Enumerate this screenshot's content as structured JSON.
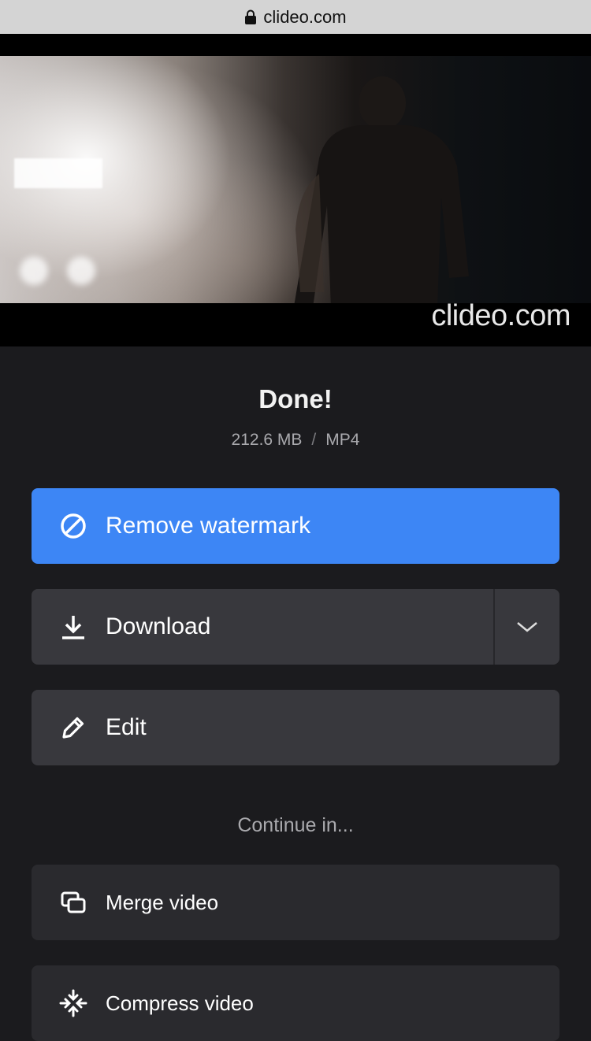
{
  "browser": {
    "url": "clideo.com",
    "lock_icon": "lock-icon"
  },
  "video": {
    "watermark": "clideo.com"
  },
  "result": {
    "title": "Done!",
    "size": "212.6 MB",
    "separator": "/",
    "format": "MP4"
  },
  "actions": {
    "remove_watermark": {
      "label": "Remove watermark",
      "icon": "no-symbol-icon"
    },
    "download": {
      "label": "Download",
      "icon": "download-icon",
      "dropdown_icon": "chevron-down-icon"
    },
    "edit": {
      "label": "Edit",
      "icon": "pencil-icon"
    }
  },
  "continue": {
    "heading": "Continue in...",
    "items": [
      {
        "label": "Merge video",
        "icon": "merge-icon"
      },
      {
        "label": "Compress video",
        "icon": "compress-icon"
      }
    ]
  },
  "colors": {
    "accent": "#3d86f5",
    "background": "#1b1b1e",
    "button": "#38383d",
    "card": "#2a2a2e"
  }
}
